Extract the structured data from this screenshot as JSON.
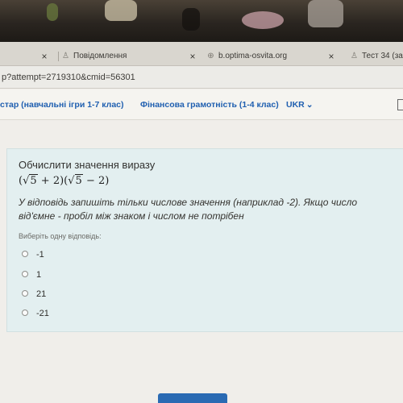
{
  "browser": {
    "tabs": [
      {
        "label": "",
        "favicon": "none"
      },
      {
        "label": "Повідомлення",
        "favicon": "person-icon"
      },
      {
        "label": "b.optima-osvita.org",
        "favicon": "globe-icon"
      },
      {
        "label": "Тест 34 (за уч",
        "favicon": "person-icon"
      }
    ],
    "close_glyph": "×",
    "url": "p?attempt=2719310&cmid=56301"
  },
  "nav": {
    "items": [
      "стар (навчальні ігри 1-7 клас)",
      "Фінансова грамотність (1-4 клас)",
      "UKR"
    ],
    "chevron": "⌄"
  },
  "question": {
    "title": "Обчислити значення виразу",
    "math": {
      "open1": "(",
      "radical1": "√",
      "radicand1": "5",
      "tail1": " + 2)(",
      "radical2": "√",
      "radicand2": "5",
      "tail2": " − 2)"
    },
    "instruction": "У відповідь запишіть тільки числове значення (наприклад -2). Якщо число від'ємне - пробіл між знаком і числом не потрібен",
    "choose_label": "Виберіть одну відповідь:",
    "options": [
      "-1",
      "1",
      "21",
      "-21"
    ]
  }
}
